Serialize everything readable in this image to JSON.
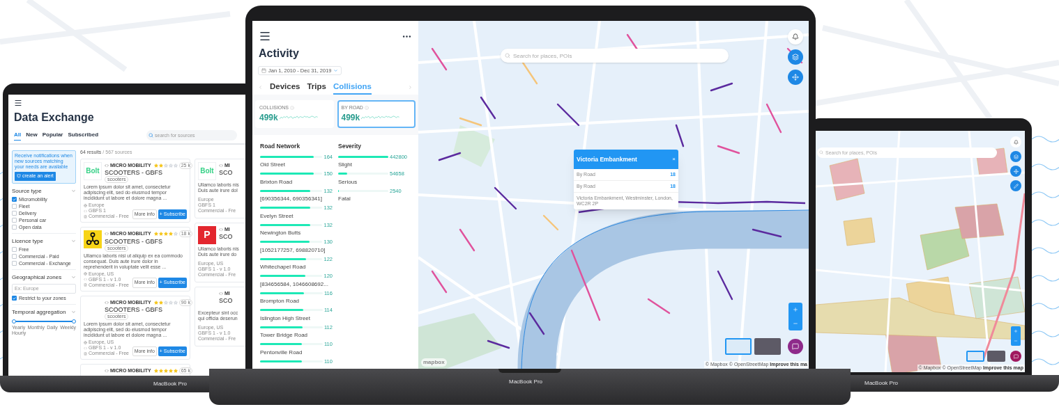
{
  "devices": [
    {
      "label": "MacBook Pro"
    },
    {
      "label": "MacBook Pro"
    },
    {
      "label": "MacBook Pro"
    }
  ],
  "data_exchange": {
    "title": "Data Exchange",
    "tabs": [
      {
        "label": "All",
        "selected": true
      },
      {
        "label": "New",
        "selected": false
      },
      {
        "label": "Popular",
        "selected": false
      },
      {
        "label": "Subscribed",
        "selected": false
      }
    ],
    "search": {
      "placeholder": "search for sources"
    },
    "results": "64 results",
    "sources": "/ 567 sources",
    "alert": {
      "text": "Receive notifications when new sources matching your needs are available",
      "button": "create an alert"
    },
    "filters": [
      {
        "kind": "checklist",
        "title": "Source type",
        "options": [
          {
            "label": "Micromobility",
            "checked": true
          },
          {
            "label": "Fleet",
            "checked": false
          },
          {
            "label": "Delivery",
            "checked": false
          },
          {
            "label": "Personal car",
            "checked": false
          },
          {
            "label": "Open data",
            "checked": false
          }
        ]
      },
      {
        "kind": "checklist",
        "title": "Licence type",
        "options": [
          {
            "label": "Free",
            "checked": false
          },
          {
            "label": "Commercial - Paid",
            "checked": false
          },
          {
            "label": "Commercial - Exchange",
            "checked": false
          }
        ]
      },
      {
        "kind": "zone",
        "title": "Geographical zones",
        "placeholder": "Ex: Europe",
        "options": [
          {
            "label": "Restrict to your zones",
            "checked": true
          }
        ]
      },
      {
        "kind": "range",
        "title": "Temporal aggregation",
        "level": 1,
        "ticks": [
          "Yearly",
          "Monthly",
          "Daily",
          "Weekly",
          "Hourly"
        ]
      }
    ],
    "cards": [
      {
        "logo": {
          "kind": "bolt",
          "text": "Bolt"
        },
        "category": "MICRO MOBILITY",
        "stars": 2,
        "reviews": "25 k",
        "title": "SCOOTERS - GBFS",
        "tag": "scooters",
        "description": "Lorem ipsum dolor sit amet, consectetur adipiscing elit, sed do eiusmod tempor incididunt ut labore et dolore magna ...",
        "meta": [
          "Europe",
          "GBFS 1",
          "Commercial - Free"
        ],
        "buttons": [
          "More info",
          "+ Subscribe"
        ]
      },
      {
        "logo": {
          "kind": "scooter"
        },
        "category": "MICRO MOBILITY",
        "stars": 4,
        "reviews": "18 k",
        "title": "SCOOTERS - GBFS",
        "tag": "scooters",
        "description": "Ullamco laboris nisi ut aliquip ex ea commodo consequat. Duis aute irure dolor in reprehenderit in voluptate velit esse ...",
        "meta": [
          "Europe, US",
          "GBFS 1 - v 1.0",
          "Commercial - Free"
        ],
        "buttons": [
          "More info",
          "+ Subscribe"
        ]
      },
      {
        "logo": {
          "kind": "none"
        },
        "category": "MICRO MOBILITY",
        "stars": 2,
        "reviews": "90 k",
        "title": "SCOOTERS - GBFS",
        "tag": "scooters",
        "description": "Lorem ipsum dolor sit amet, consectetur adipiscing elit, sed do eiusmod tempor incididunt ut labore et dolore magna ...",
        "meta": [
          "Europe, US",
          "GBFS 1 - v 1.0",
          "Commercial - Free"
        ],
        "buttons": [
          "More info",
          "+ Subscribe"
        ]
      },
      {
        "logo": {
          "kind": "none"
        },
        "category": "MICRO MOBILITY",
        "stars": 5,
        "reviews": "65 k"
      }
    ],
    "cards_cut": [
      {
        "logo": {
          "kind": "bolt",
          "text": "Bolt"
        },
        "category": "MI",
        "title": "SCO",
        "description": [
          "Ullamco laboris nis",
          "Duis aute irure dol"
        ],
        "meta": [
          "Europe",
          "GBFS 1",
          "Commercial - Fre"
        ]
      },
      {
        "logo": {
          "kind": "parking",
          "text": "P"
        },
        "category": "MI",
        "title": "SCO",
        "description": [
          "Ullamco laboris nis",
          "Duis aute irure do"
        ],
        "meta": [
          "Europe, US",
          "GBFS 1 - v 1.0",
          "Commercial - Fre"
        ]
      },
      {
        "logo": {
          "kind": "none"
        },
        "category": "MI",
        "title": "SCO",
        "description": [
          "Excepteur sint occ",
          "qui officia deserun"
        ],
        "meta": [
          "Europe, US",
          "GBFS 1 - v 1.0",
          "Commercial - Fre"
        ]
      }
    ]
  },
  "activity": {
    "title": "Activity",
    "date_range": "Jan 1, 2010 - Dec 31, 2019",
    "tabs": [
      {
        "label": "Devices",
        "selected": false
      },
      {
        "label": "Trips",
        "selected": false
      },
      {
        "label": "Collisions",
        "selected": true
      }
    ],
    "stats": [
      {
        "label": "COLLISIONS",
        "value": "499k",
        "selected": false
      },
      {
        "label": "BY ROAD",
        "value": "499k",
        "selected": true
      }
    ],
    "road_network": {
      "title": "Road Network",
      "rows": [
        {
          "name": "Old Street",
          "value": "164",
          "level": 0.86
        },
        {
          "name": "Brixton Road",
          "value": "150",
          "level": 0.86
        },
        {
          "name": "[690356344, 690356341]",
          "value": "132",
          "level": 0.8
        },
        {
          "name": "Evelyn Street",
          "value": "132",
          "level": 0.8
        },
        {
          "name": "Newington Butts",
          "value": "132",
          "level": 0.8
        },
        {
          "name": "[1052177257, 698820710]",
          "value": "130",
          "level": 0.79
        },
        {
          "name": "Whitechapel Road",
          "value": "122",
          "level": 0.74
        },
        {
          "name": "[834656584, 1046608692...",
          "value": "120",
          "level": 0.73
        },
        {
          "name": "Brompton Road",
          "value": "116",
          "level": 0.7
        },
        {
          "name": "Islington High Street",
          "value": "114",
          "level": 0.69
        },
        {
          "name": "Tower Bridge Road",
          "value": "112",
          "level": 0.68
        },
        {
          "name": "Pentonville Road",
          "value": "110",
          "level": 0.67
        },
        {
          "value": "110",
          "level": 0.67
        }
      ]
    },
    "severity": {
      "title": "Severity",
      "rows": [
        {
          "name": "Slight",
          "value": "442800",
          "level": 1
        },
        {
          "name": "Serious",
          "value": "54658",
          "level": 0.18
        },
        {
          "name": "Fatal",
          "value": "2540",
          "level": 0.02
        }
      ]
    }
  },
  "map": {
    "search": {
      "placeholder": "Search for places, POIs"
    },
    "popup": {
      "title": "Victoria Embankment",
      "close": "×",
      "rows": [
        {
          "label": "By Road",
          "value": "18"
        },
        {
          "label": "By Road",
          "value": "18"
        }
      ],
      "address": "Victoria Embankment, Westminster, London, WC2R 2P"
    },
    "styles": [
      {
        "kind": "streets",
        "selected": true
      },
      {
        "kind": "satellite",
        "selected": false
      }
    ],
    "logo": "mapbox",
    "attribution": "© Mapbox © OpenStreetMap",
    "improve": "Improve this ma"
  },
  "side_map": {
    "search": {
      "placeholder": "Search for places, POIs"
    },
    "styles": [
      {
        "kind": "streets",
        "selected": true
      },
      {
        "kind": "satellite",
        "selected": false
      }
    ],
    "attribution": "© Mapbox © OpenStreetMap",
    "improve": "Improve this map"
  }
}
